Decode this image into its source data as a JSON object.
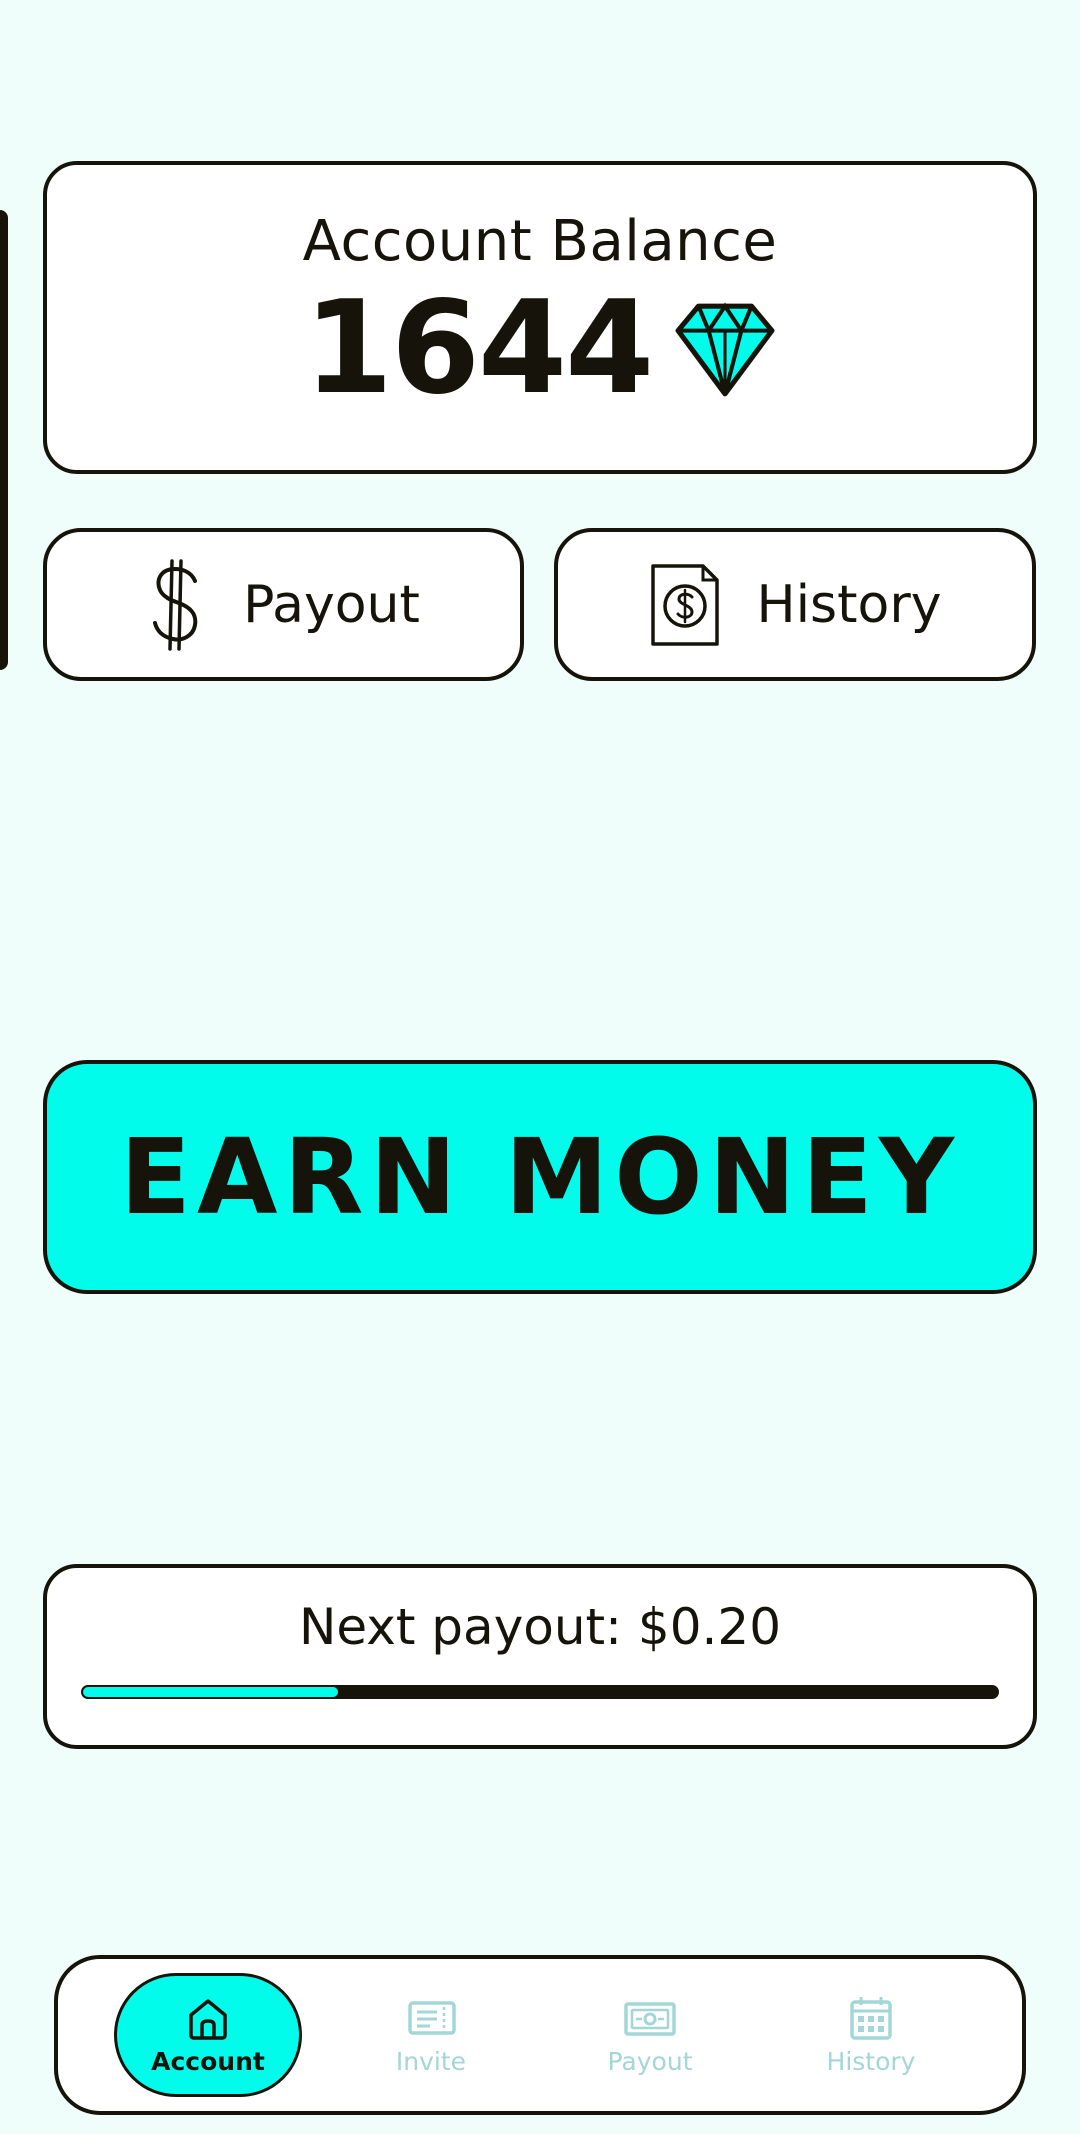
{
  "balance": {
    "title": "Account Balance",
    "value": "1644",
    "currency_icon": "diamond-icon"
  },
  "actions": {
    "payout_label": "Payout",
    "payout_icon": "dollar-icon",
    "history_label": "History",
    "history_icon": "receipt-icon"
  },
  "earn": {
    "label": "EARN MONEY"
  },
  "next_payout": {
    "label": "Next payout: $0.20",
    "progress_fraction": 0.28
  },
  "nav": {
    "items": [
      {
        "label": "Account",
        "icon": "home-icon",
        "active": true
      },
      {
        "label": "Invite",
        "icon": "ticket-icon",
        "active": false
      },
      {
        "label": "Payout",
        "icon": "banknote-icon",
        "active": false
      },
      {
        "label": "History",
        "icon": "calendar-icon",
        "active": false
      }
    ]
  },
  "colors": {
    "accent": "#02fcec",
    "background": "#effdfb",
    "ink": "#16140a",
    "inactive_nav": "#a3d6d6"
  }
}
